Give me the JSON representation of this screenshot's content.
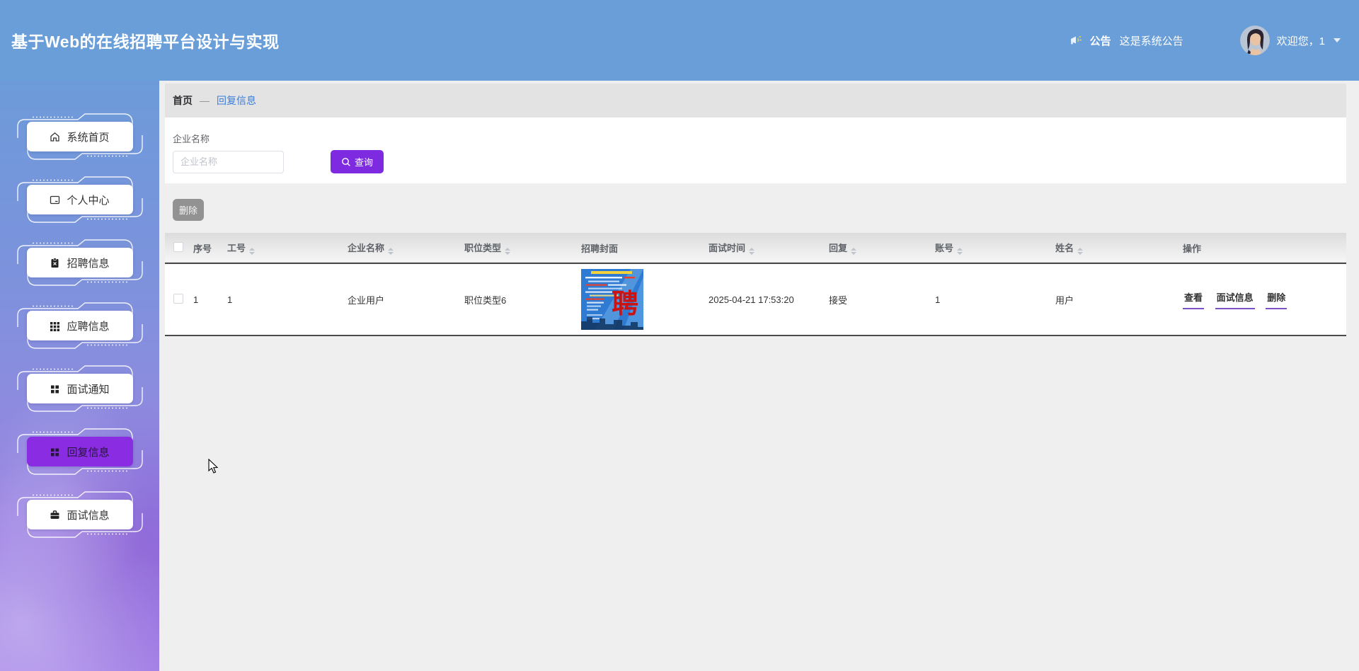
{
  "header": {
    "title": "基于Web的在线招聘平台设计与实现",
    "announcement_label": "公告",
    "announcement_text": "这是系统公告",
    "welcome_text": "欢迎您，1"
  },
  "sidebar": {
    "items": [
      {
        "label": "系统首页",
        "icon": "home-icon",
        "active": false
      },
      {
        "label": "个人中心",
        "icon": "idcard-icon",
        "active": false
      },
      {
        "label": "招聘信息",
        "icon": "clipboard-icon",
        "active": false
      },
      {
        "label": "应聘信息",
        "icon": "grid9-icon",
        "active": false
      },
      {
        "label": "面试通知",
        "icon": "grid4-icon",
        "active": false
      },
      {
        "label": "回复信息",
        "icon": "grid4-icon",
        "active": true
      },
      {
        "label": "面试信息",
        "icon": "briefcase-icon",
        "active": false
      }
    ]
  },
  "breadcrumb": {
    "home": "首页",
    "separator": "—",
    "current": "回复信息"
  },
  "search": {
    "label": "企业名称",
    "placeholder": "企业名称",
    "value": "",
    "button_label": "查询"
  },
  "toolbar": {
    "delete_label": "删除"
  },
  "table": {
    "columns": [
      {
        "label": "序号",
        "sortable": false
      },
      {
        "label": "工号",
        "sortable": true
      },
      {
        "label": "企业名称",
        "sortable": true
      },
      {
        "label": "职位类型",
        "sortable": true
      },
      {
        "label": "招聘封面",
        "sortable": false
      },
      {
        "label": "面试时间",
        "sortable": true
      },
      {
        "label": "回复",
        "sortable": true
      },
      {
        "label": "账号",
        "sortable": true
      },
      {
        "label": "姓名",
        "sortable": true
      },
      {
        "label": "操作",
        "sortable": false
      }
    ],
    "rows": [
      {
        "xuhao": "1",
        "gonghao": "1",
        "company": "企业用户",
        "job_type": "职位类型6",
        "cover_char": "聘",
        "interview_time": "2025-04-21 17:53:20",
        "reply": "接受",
        "account": "1",
        "name": "用户",
        "actions": [
          "查看",
          "面试信息",
          "删除"
        ]
      }
    ]
  },
  "colors": {
    "header_blue": "#699ed8",
    "accent_purple": "#7d2ae0",
    "active_item_purple": "#8a2ce2",
    "link_blue": "#3d7edb",
    "action_underline_purple": "#7b52c8"
  }
}
